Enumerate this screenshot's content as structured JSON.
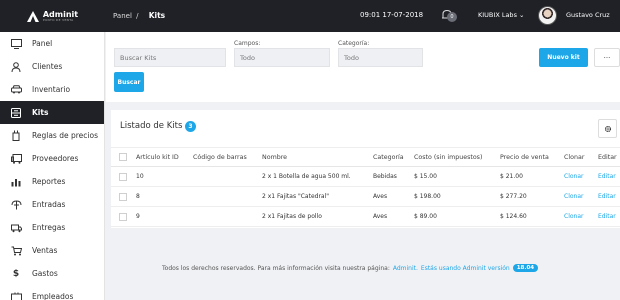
{
  "brand": {
    "name": "Adminit",
    "tagline": "PUNTO DE VENTA"
  },
  "header": {
    "breadcrumb_root": "Panel",
    "breadcrumb_sep": "/",
    "breadcrumb_current": "Kits",
    "datetime": "09:01 17-07-2018",
    "notifications_count": "0",
    "company": "KIUBIX Labs",
    "user_name": "Gustavo Cruz"
  },
  "sidebar": {
    "items": [
      {
        "label": "Panel",
        "icon": "dashboard-icon"
      },
      {
        "label": "Clientes",
        "icon": "user-icon"
      },
      {
        "label": "Inventario",
        "icon": "car-icon"
      },
      {
        "label": "Kits",
        "icon": "kits-icon",
        "active": true
      },
      {
        "label": "Reglas de precios",
        "icon": "price-tag-icon"
      },
      {
        "label": "Proveedores",
        "icon": "vehicle-icon"
      },
      {
        "label": "Reportes",
        "icon": "bar-chart-icon"
      },
      {
        "label": "Entradas",
        "icon": "entries-icon"
      },
      {
        "label": "Entregas",
        "icon": "truck-icon"
      },
      {
        "label": "Ventas",
        "icon": "cart-icon"
      },
      {
        "label": "Gastos",
        "icon": "dollar-icon"
      },
      {
        "label": "Empleados",
        "icon": "employees-icon"
      }
    ]
  },
  "filters": {
    "search_placeholder": "Buscar Kits",
    "campos_label": "Campos:",
    "campos_value": "Todo",
    "categoria_label": "Categoría:",
    "categoria_value": "Todo",
    "search_button": "Buscar",
    "new_button": "Nuevo kit",
    "more_button": "···"
  },
  "listing": {
    "title": "Listado de Kits",
    "count": "3",
    "columns": [
      "Artículo kit ID",
      "Código de barras",
      "Nombre",
      "Categoría",
      "Costo (sin impuestos)",
      "Precio de venta",
      "Clonar",
      "Editar"
    ],
    "rows": [
      {
        "id": "10",
        "barcode": "",
        "name": "2 x 1 Botella de agua 500 ml.",
        "category": "Bebidas",
        "cost": "$ 15.00",
        "price": "$ 21.00",
        "clone": "Clonar",
        "edit": "Editar"
      },
      {
        "id": "8",
        "barcode": "",
        "name": "2 x1 Fajitas \"Catedral\"",
        "category": "Aves",
        "cost": "$ 198.00",
        "price": "$ 277.20",
        "clone": "Clonar",
        "edit": "Editar"
      },
      {
        "id": "9",
        "barcode": "",
        "name": "2 x1 Fajitas de pollo",
        "category": "Aves",
        "cost": "$ 89.00",
        "price": "$ 124.60",
        "clone": "Clonar",
        "edit": "Editar"
      }
    ]
  },
  "footer": {
    "text": "Todos los derechos reservados. Para más información visita nuestra página:",
    "link": "Adminit.",
    "version_text": "Estás usando Adminit versión",
    "version": "18.04"
  },
  "colors": {
    "accent": "#1ea7e8",
    "topbar": "#1f2126",
    "background": "#f0f1f4"
  }
}
